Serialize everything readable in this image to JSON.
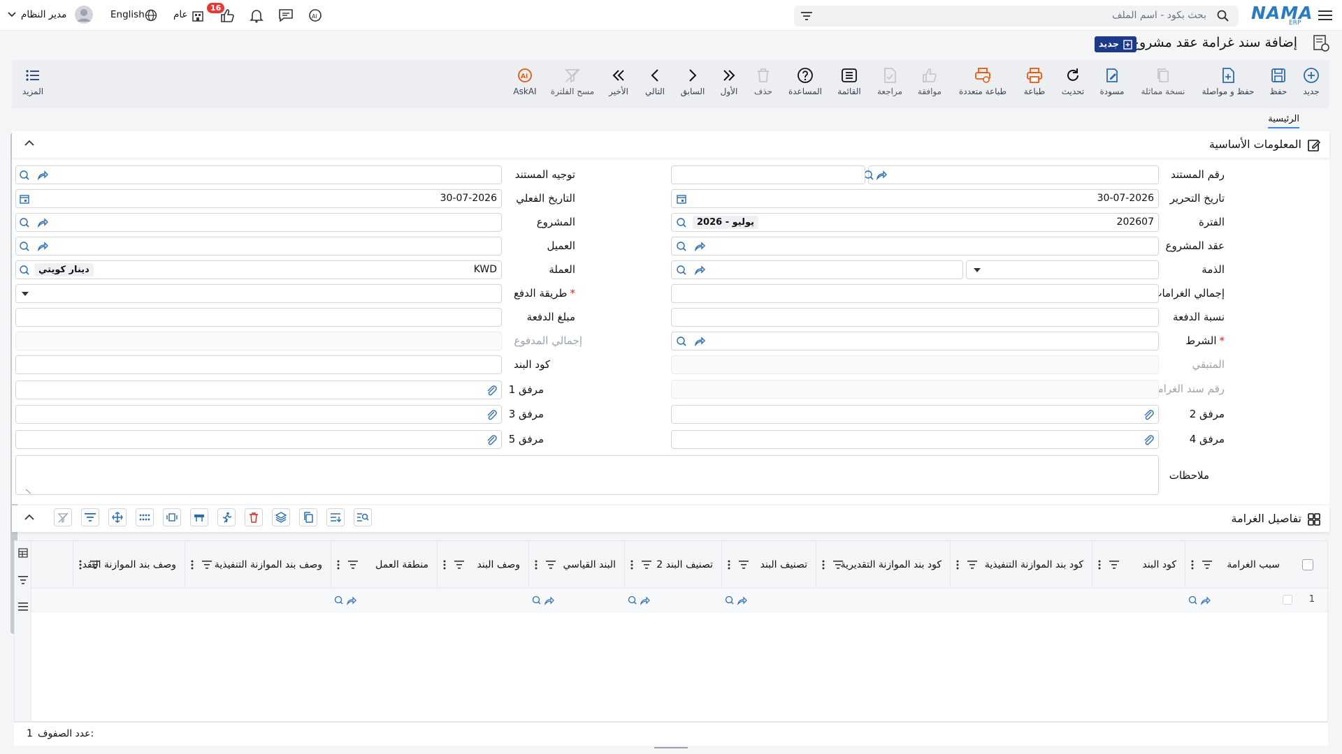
{
  "app": {
    "logo": "NAMA",
    "logo_sub": "ERP"
  },
  "top": {
    "search_placeholder": "بحث بكود - اسم الملف",
    "language": "English",
    "company": "عام",
    "notif_count": "16",
    "user": "مدير النظام"
  },
  "title": "إضافة سند غرامة عقد مشروع",
  "new_tag": "جديد",
  "toolbar": {
    "new": "جديد",
    "save": "حفظ",
    "save_continue": "حفظ و مواصلة",
    "copy": "نسخة مماثلة",
    "draft": "مسودة",
    "refresh": "تحديث",
    "print": "طباعة",
    "multi_print": "طباعة متعددة",
    "approve": "موافقة",
    "review": "مراجعة",
    "list": "القائمة",
    "help": "المساعدة",
    "delete": "حذف",
    "first": "الأول",
    "previous": "السابق",
    "next": "التالي",
    "last": "الأخير",
    "clear_filter": "مسح الفلترة",
    "askai": "AskAI",
    "more": "المزيد"
  },
  "tabs": {
    "main": "الرئيسية"
  },
  "basic": {
    "title": "المعلومات الأساسية",
    "doc_no": "رقم المستند",
    "doc_direction": "توجيه المستند",
    "edit_date": "تاريخ التحرير",
    "edit_date_val": "30-07-2026",
    "actual_date": "التاريخ الفعلي",
    "actual_date_val": "30-07-2026",
    "period": "الفترة",
    "period_val": "202607",
    "period_chip": "2026 - يوليو",
    "project": "المشروع",
    "contract": "عقد المشروع",
    "customer": "العميل",
    "dues": "الذمة",
    "currency": "العملة",
    "currency_val": "KWD",
    "currency_chip": "دينار كويتي",
    "total_fines": "إجمالي الغرامات",
    "payment_method": "طريقة الدفع",
    "payment_pct": "نسبة الدفعة",
    "payment_amount": "مبلغ الدفعة",
    "condition": "الشرط",
    "total_paid": "إجمالي المدفوع",
    "remaining": "المتبقي",
    "item_code": "كود البند",
    "fine_no": "رقم سند الغرامة",
    "att1": "مرفق 1",
    "att2": "مرفق 2",
    "att3": "مرفق 3",
    "att4": "مرفق 4",
    "att5": "مرفق 5",
    "notes": "ملاحظات"
  },
  "details": {
    "title": "تفاصيل الغرامة",
    "columns": [
      "سبب الغرامة",
      "كود البند",
      "كود بند الموازنة التنفيذية",
      "كود بند الموازنة التقديرية",
      "تصنيف البند",
      "تصنيف البند 2",
      "البند القياسي",
      "وصف البند",
      "منطقة العمل",
      "وصف بند الموازنة التنفيذية",
      "وصف بند الموازنة التقد"
    ],
    "row_no": "1",
    "row_count_label": "عدد الصفوف:",
    "row_count": "1"
  },
  "colors": {
    "brand": "#1d3a8a",
    "accent": "#2b6cb0",
    "orange": "#e8590c"
  }
}
